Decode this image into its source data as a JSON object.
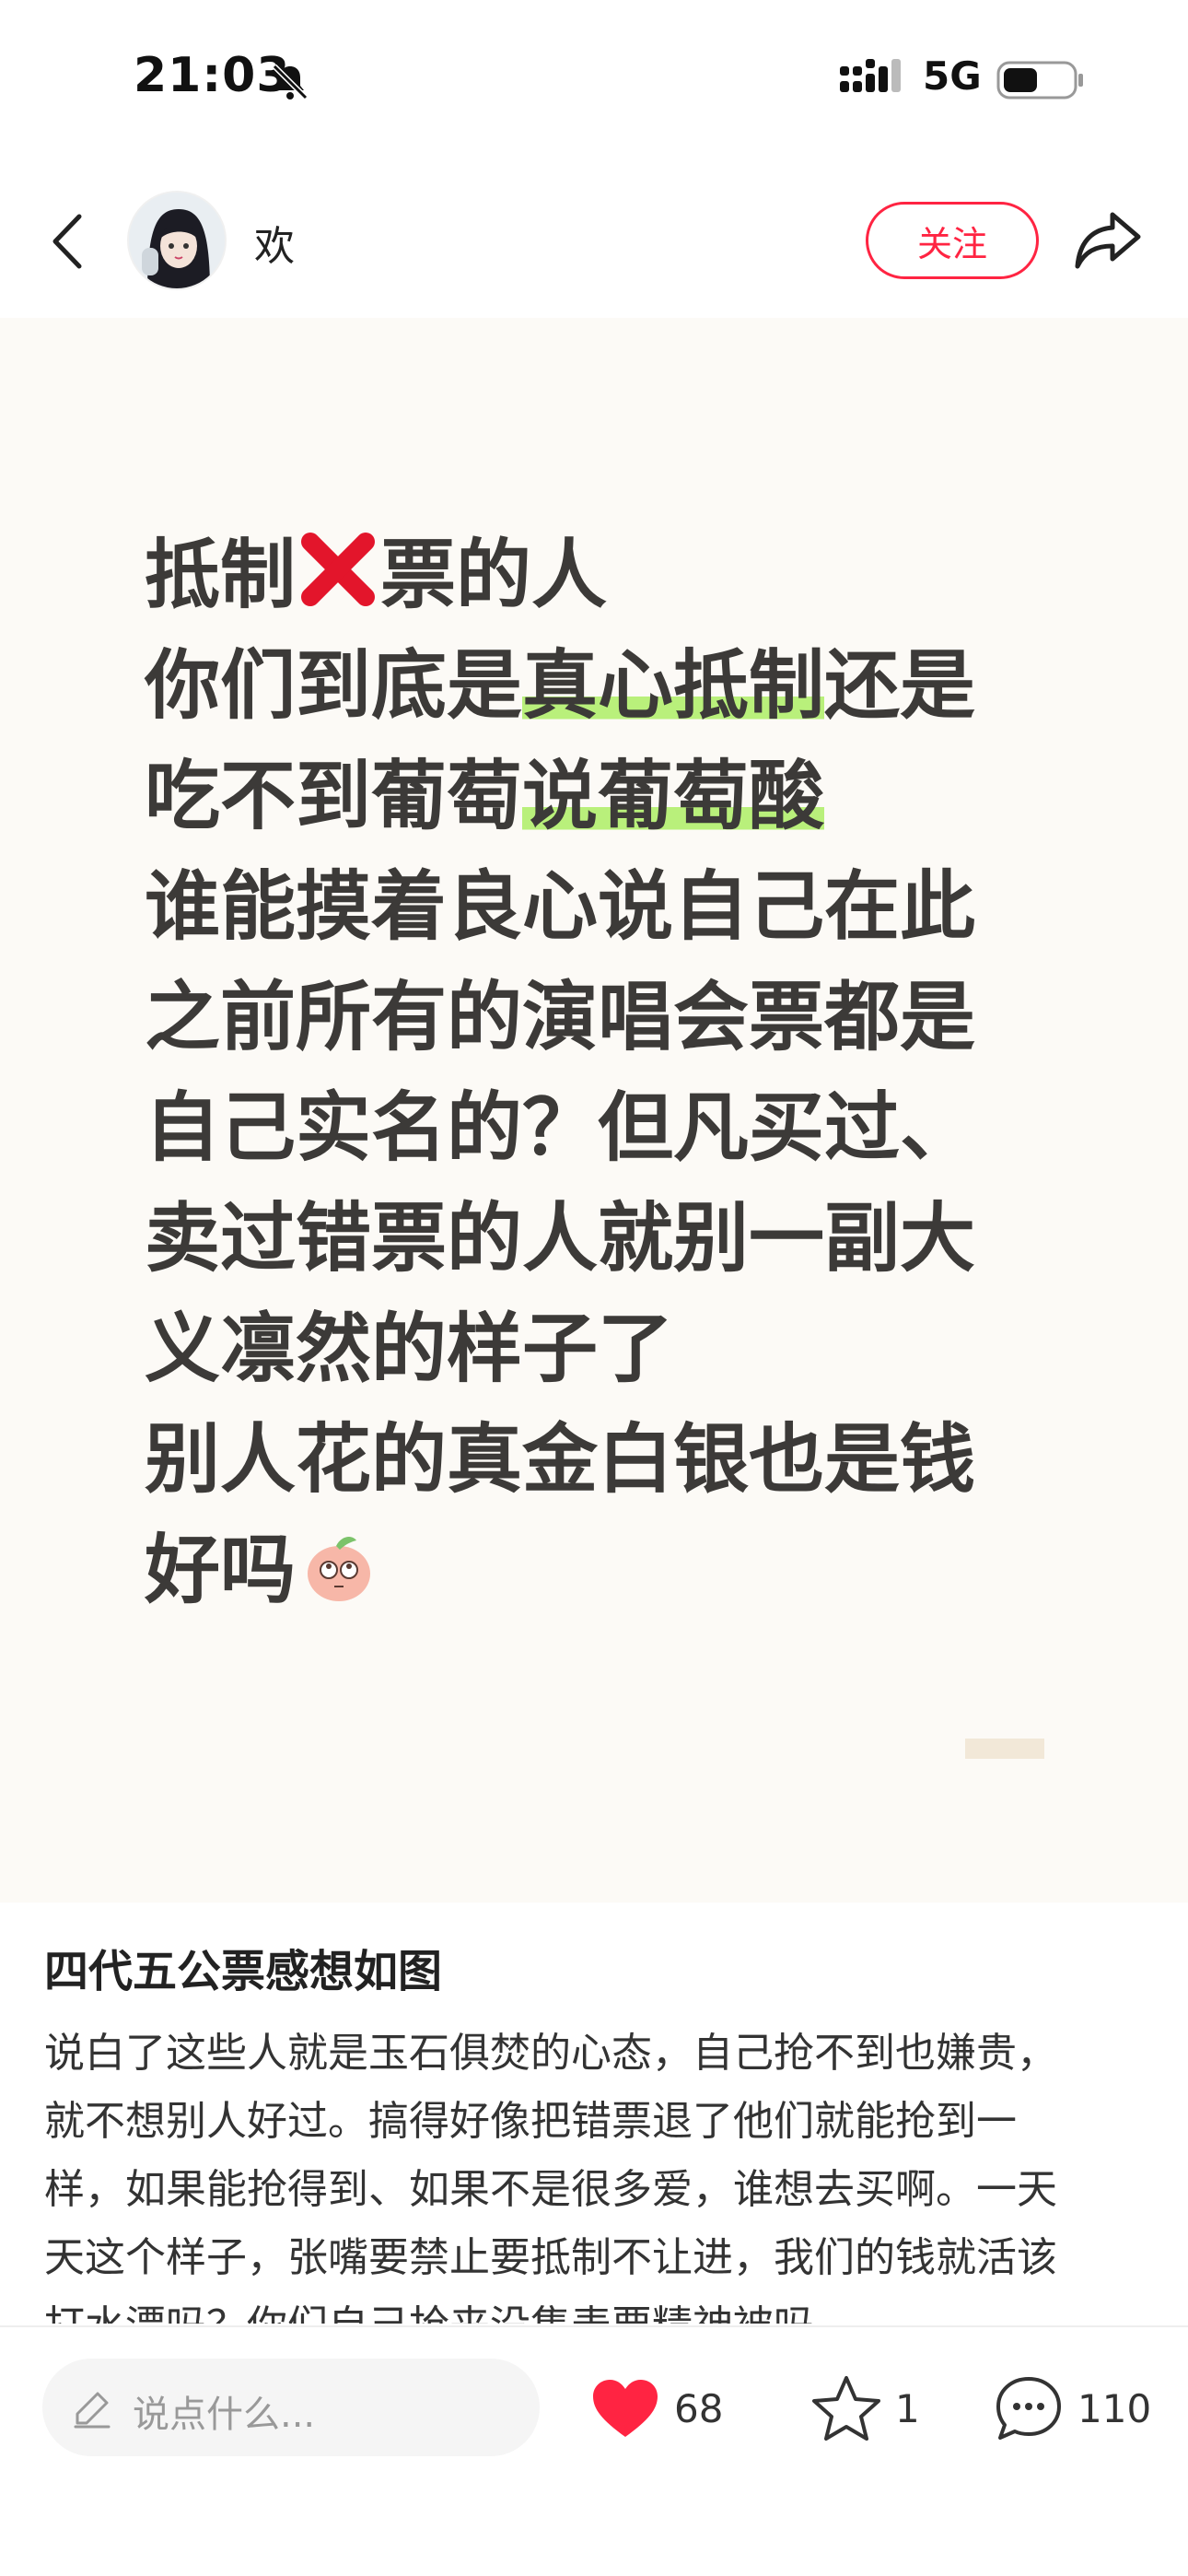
{
  "status_bar": {
    "time": "21:03",
    "network": "5G",
    "icons": [
      "bell-muted-icon",
      "signal-icon",
      "battery-icon"
    ]
  },
  "header": {
    "back_icon": "chevron-left-icon",
    "author_name": "欢",
    "follow_label": "关注",
    "share_icon": "share-arrow-icon"
  },
  "image_card": {
    "background": "#fcfaf6",
    "highlight_color": "#b9f07b",
    "lines": [
      {
        "a": "抵制",
        "b": "票的人"
      },
      {
        "a": "你们到底是",
        "hl": "真心抵制",
        "b": "还是"
      },
      {
        "a": "吃不到葡萄",
        "hl": "说葡萄酸"
      },
      {
        "a": "谁能摸着良心说自己在此"
      },
      {
        "a": "之前所有的演唱会票都是"
      },
      {
        "a": "自己实名的？但凡买过、"
      },
      {
        "a": "卖过错票的人就别一副大"
      },
      {
        "a": "义凛然的样子了"
      },
      {
        "a": "别人花的真金白银也是钱"
      },
      {
        "a": "好吗"
      }
    ]
  },
  "post": {
    "title": "四代五公票感想如图",
    "body_lines": [
      "说白了这些人就是玉石俱焚的心态，自己抢不到也嫌贵，",
      "就不想别人好过。搞得好像把错票退了他们就能抢到一",
      "样，如果能抢得到、如果不是很多爱，谁想去买啊。一天",
      "天这个样子，张嘴要禁止要抵制不让进，我们的钱就活该",
      "打水漂吗？你们自己抢来没集表要精神被吗"
    ]
  },
  "bottom_bar": {
    "comment_placeholder": "说点什么...",
    "likes": "68",
    "collects": "1",
    "comments": "110",
    "like_color": "#ff2442"
  }
}
